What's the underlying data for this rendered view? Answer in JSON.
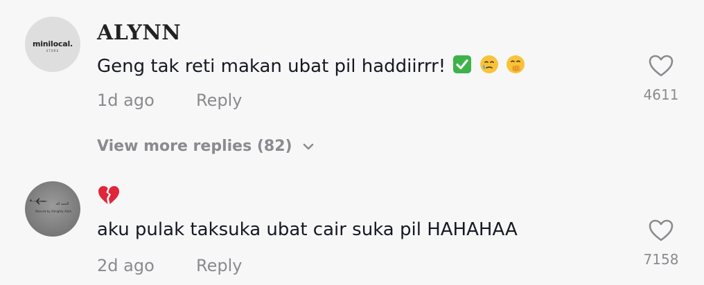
{
  "comments": [
    {
      "username": "ALYNN",
      "avatar_logo": "minilocal.",
      "avatar_logo_sub": "STORE",
      "text": "Geng tak reti makan ubat pil haddiirrr!",
      "emojis": [
        "check-mark-button-icon",
        "crying-face-icon",
        "face-with-hand-over-mouth-icon"
      ],
      "time": "1d ago",
      "reply_label": "Reply",
      "likes": "4611",
      "view_more": "View more replies (82)"
    },
    {
      "username_emoji": "broken-heart-icon",
      "avatar_arabic": "الحمد لله",
      "avatar_caption": "Blessed by Almighty Allah",
      "text": "aku pulak taksuka ubat cair suka pil HAHAHAA",
      "time": "2d ago",
      "reply_label": "Reply",
      "likes": "7158"
    }
  ],
  "colors": {
    "background": "#f7f7f7",
    "text": "#161823",
    "muted": "#8a8a8f",
    "check_green": "#3db24a",
    "broken_heart_red": "#e0263a"
  }
}
